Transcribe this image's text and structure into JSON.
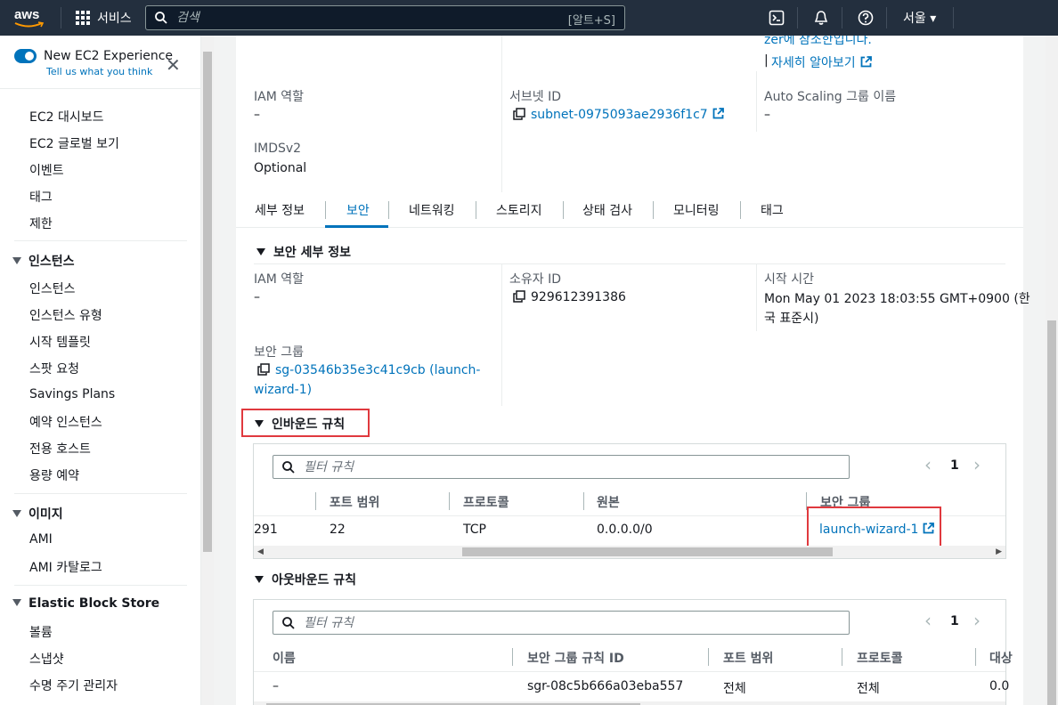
{
  "topnav": {
    "logo_text": "aws",
    "services_label": "서비스",
    "search_placeholder": "검색",
    "search_shortcut": "[알트+S]",
    "region": "서울 ▾"
  },
  "sidebar": {
    "new_experience": "New EC2 Experience",
    "tell_us": "Tell us what you think",
    "top_items": [
      "EC2 대시보드",
      "EC2 글로벌 보기",
      "이벤트",
      "태그",
      "제한"
    ],
    "sections": [
      {
        "title": "인스턴스",
        "items": [
          "인스턴스",
          "인스턴스 유형",
          "시작 템플릿",
          "스팟 요청",
          "Savings Plans",
          "예약 인스턴스",
          "전용 호스트",
          "용량 예약"
        ]
      },
      {
        "title": "이미지",
        "items": [
          "AMI",
          "AMI 카탈로그"
        ]
      },
      {
        "title": "Elastic Block Store",
        "items": [
          "볼륨",
          "스냅샷",
          "수명 주기 관리자"
        ]
      }
    ]
  },
  "details": {
    "cut_text": "zer에 참조한입니다.",
    "learn_more": "자세히 알아보기",
    "learn_more_prefix": "|",
    "iam_role_label": "IAM 역할",
    "iam_role_value": "–",
    "subnet_label": "서브넷 ID",
    "subnet_value": "subnet-0975093ae2936f1c7",
    "asg_label": "Auto Scaling 그룹 이름",
    "asg_value": "–",
    "imds_label": "IMDSv2",
    "imds_value": "Optional"
  },
  "tabs": [
    "세부 정보",
    "보안",
    "네트워킹",
    "스토리지",
    "상태 검사",
    "모니터링",
    "태그"
  ],
  "security": {
    "title": "보안 세부 정보",
    "iam_role_label": "IAM 역할",
    "iam_role_value": "–",
    "owner_label": "소유자 ID",
    "owner_value": "929612391386",
    "launch_label": "시작 시간",
    "launch_value_1": "Mon May 01 2023 18:03:55 GMT+0900 (한",
    "launch_value_2": "국 표준시)",
    "sg_label": "보안 그룹",
    "sg_value_1": "sg-03546b35e3c41c9cb (launch-",
    "sg_value_2": "wizard-1)"
  },
  "inbound": {
    "title": "인바운드 규칙",
    "filter_placeholder": "필터 규칙",
    "page": "1",
    "columns": [
      "포트 범위",
      "프로토콜",
      "원본",
      "보안 그룹"
    ],
    "row": {
      "cut": "291",
      "port": "22",
      "protocol": "TCP",
      "source": "0.0.0.0/0",
      "sg": "launch-wizard-1"
    }
  },
  "outbound": {
    "title": "아웃바운드 규칙",
    "filter_placeholder": "필터 규칙",
    "page": "1",
    "columns": [
      "이름",
      "보안 그룹 규칙 ID",
      "포트 범위",
      "프로토콜",
      "대상"
    ],
    "row": {
      "name": "–",
      "rule_id": "sgr-08c5b666a03eba557",
      "port": "전체",
      "protocol": "전체",
      "dest": "0.0"
    }
  },
  "colors": {
    "nav": "#232f3e",
    "link": "#0073bb",
    "highlight": "#e0393e"
  }
}
